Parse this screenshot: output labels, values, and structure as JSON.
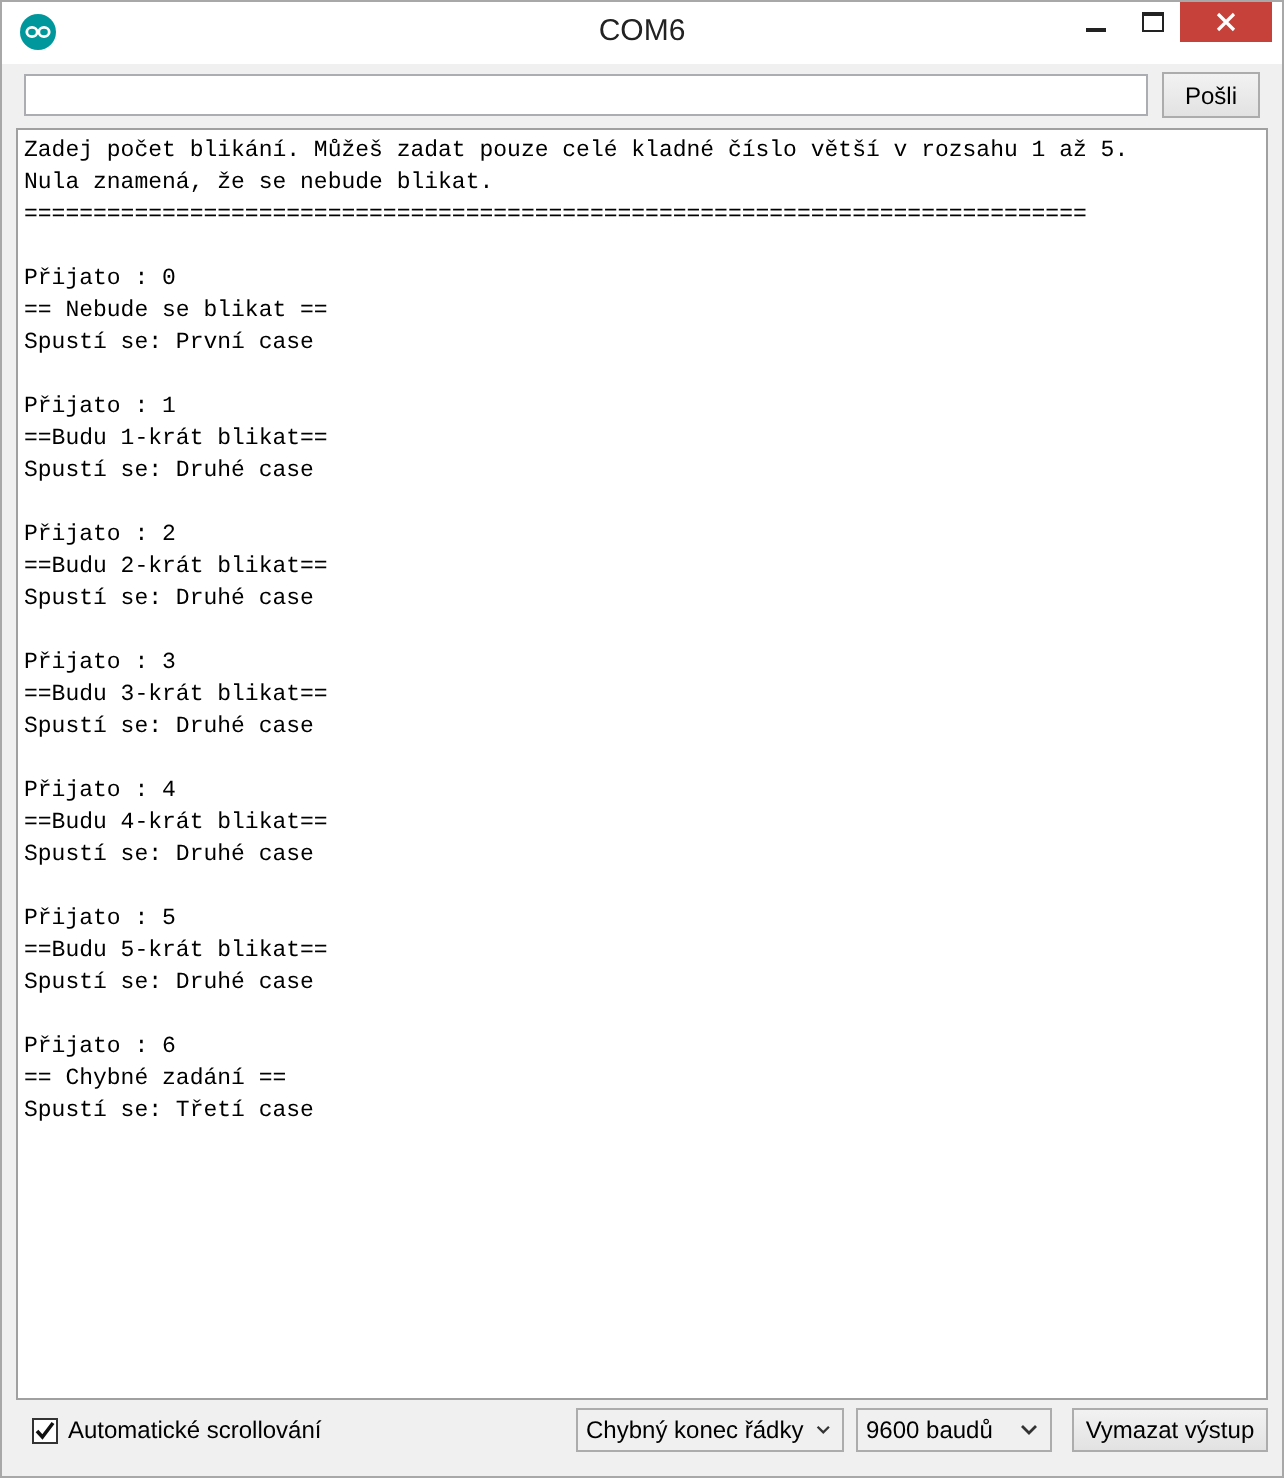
{
  "window": {
    "title": "COM6"
  },
  "send_button": "Pošli",
  "output": {
    "header": [
      "Zadej počet blikání. Můžeš zadat pouze celé kladné číslo větší v rozsahu 1 až 5.",
      "Nula znamená, že se nebude blikat.",
      "============================================================================="
    ],
    "groups": [
      [
        "Přijato : 0",
        "== Nebude se blikat ==",
        "Spustí se: První case"
      ],
      [
        "Přijato : 1",
        "==Budu 1-krát blikat==",
        "Spustí se: Druhé case"
      ],
      [
        "Přijato : 2",
        "==Budu 2-krát blikat==",
        "Spustí se: Druhé case"
      ],
      [
        "Přijato : 3",
        "==Budu 3-krát blikat==",
        "Spustí se: Druhé case"
      ],
      [
        "Přijato : 4",
        "==Budu 4-krát blikat==",
        "Spustí se: Druhé case"
      ],
      [
        "Přijato : 5",
        "==Budu 5-krát blikat==",
        "Spustí se: Druhé case"
      ],
      [
        "Přijato : 6",
        "== Chybné zadání ==",
        "Spustí se: Třetí case"
      ]
    ]
  },
  "autoscroll": {
    "label": "Automatické scrollování",
    "checked": true
  },
  "line_ending": "Chybný konec řádky",
  "baud_rate": "9600 baudů",
  "clear_button": "Vymazat výstup"
}
